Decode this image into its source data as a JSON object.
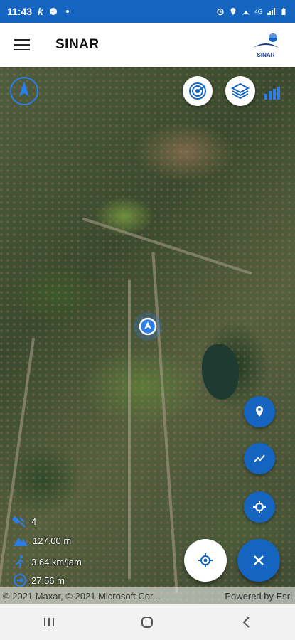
{
  "status_bar": {
    "time": "11:43",
    "app_k": "k",
    "battery_text": "4G"
  },
  "app_bar": {
    "title": "SINAR",
    "logo_text": "SINAR"
  },
  "map": {
    "info": {
      "accuracy": "4",
      "altitude": "127.00 m",
      "speed": "3.64 km/jam",
      "distance": "27.56 m"
    },
    "attribution": {
      "left": "© 2021 Maxar, © 2021 Microsoft Cor...",
      "right": "Powered by Esri"
    }
  },
  "icons": {
    "compass": "compass-icon",
    "radar": "radar-icon",
    "layers": "layers-icon",
    "marker": "map-marker-icon",
    "chart": "chart-line-icon",
    "crosshair": "crosshair-icon",
    "location": "location-target-icon",
    "close": "close-icon"
  },
  "colors": {
    "primary": "#1565c0",
    "status_bar": "#1565c0",
    "appbar": "#ffffff"
  }
}
